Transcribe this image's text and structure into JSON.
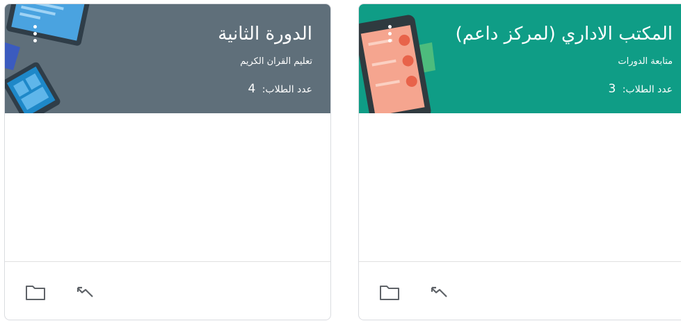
{
  "cards": [
    {
      "title": "الدورة الثانية",
      "subtitle": "تعليم القران الكريم",
      "students_label": "عدد الطلاب:",
      "students_count": "4",
      "header_color": "#5f6f7a",
      "icons": [
        "more-vert-icon",
        "folder-icon",
        "trending-icon"
      ]
    },
    {
      "title": "المكتب الاداري (لمركز داعم)",
      "subtitle": "متابعة الدورات",
      "students_label": "عدد الطلاب:",
      "students_count": "3",
      "header_color": "#0f9d86",
      "icons": [
        "more-vert-icon",
        "folder-icon",
        "trending-icon"
      ]
    }
  ]
}
